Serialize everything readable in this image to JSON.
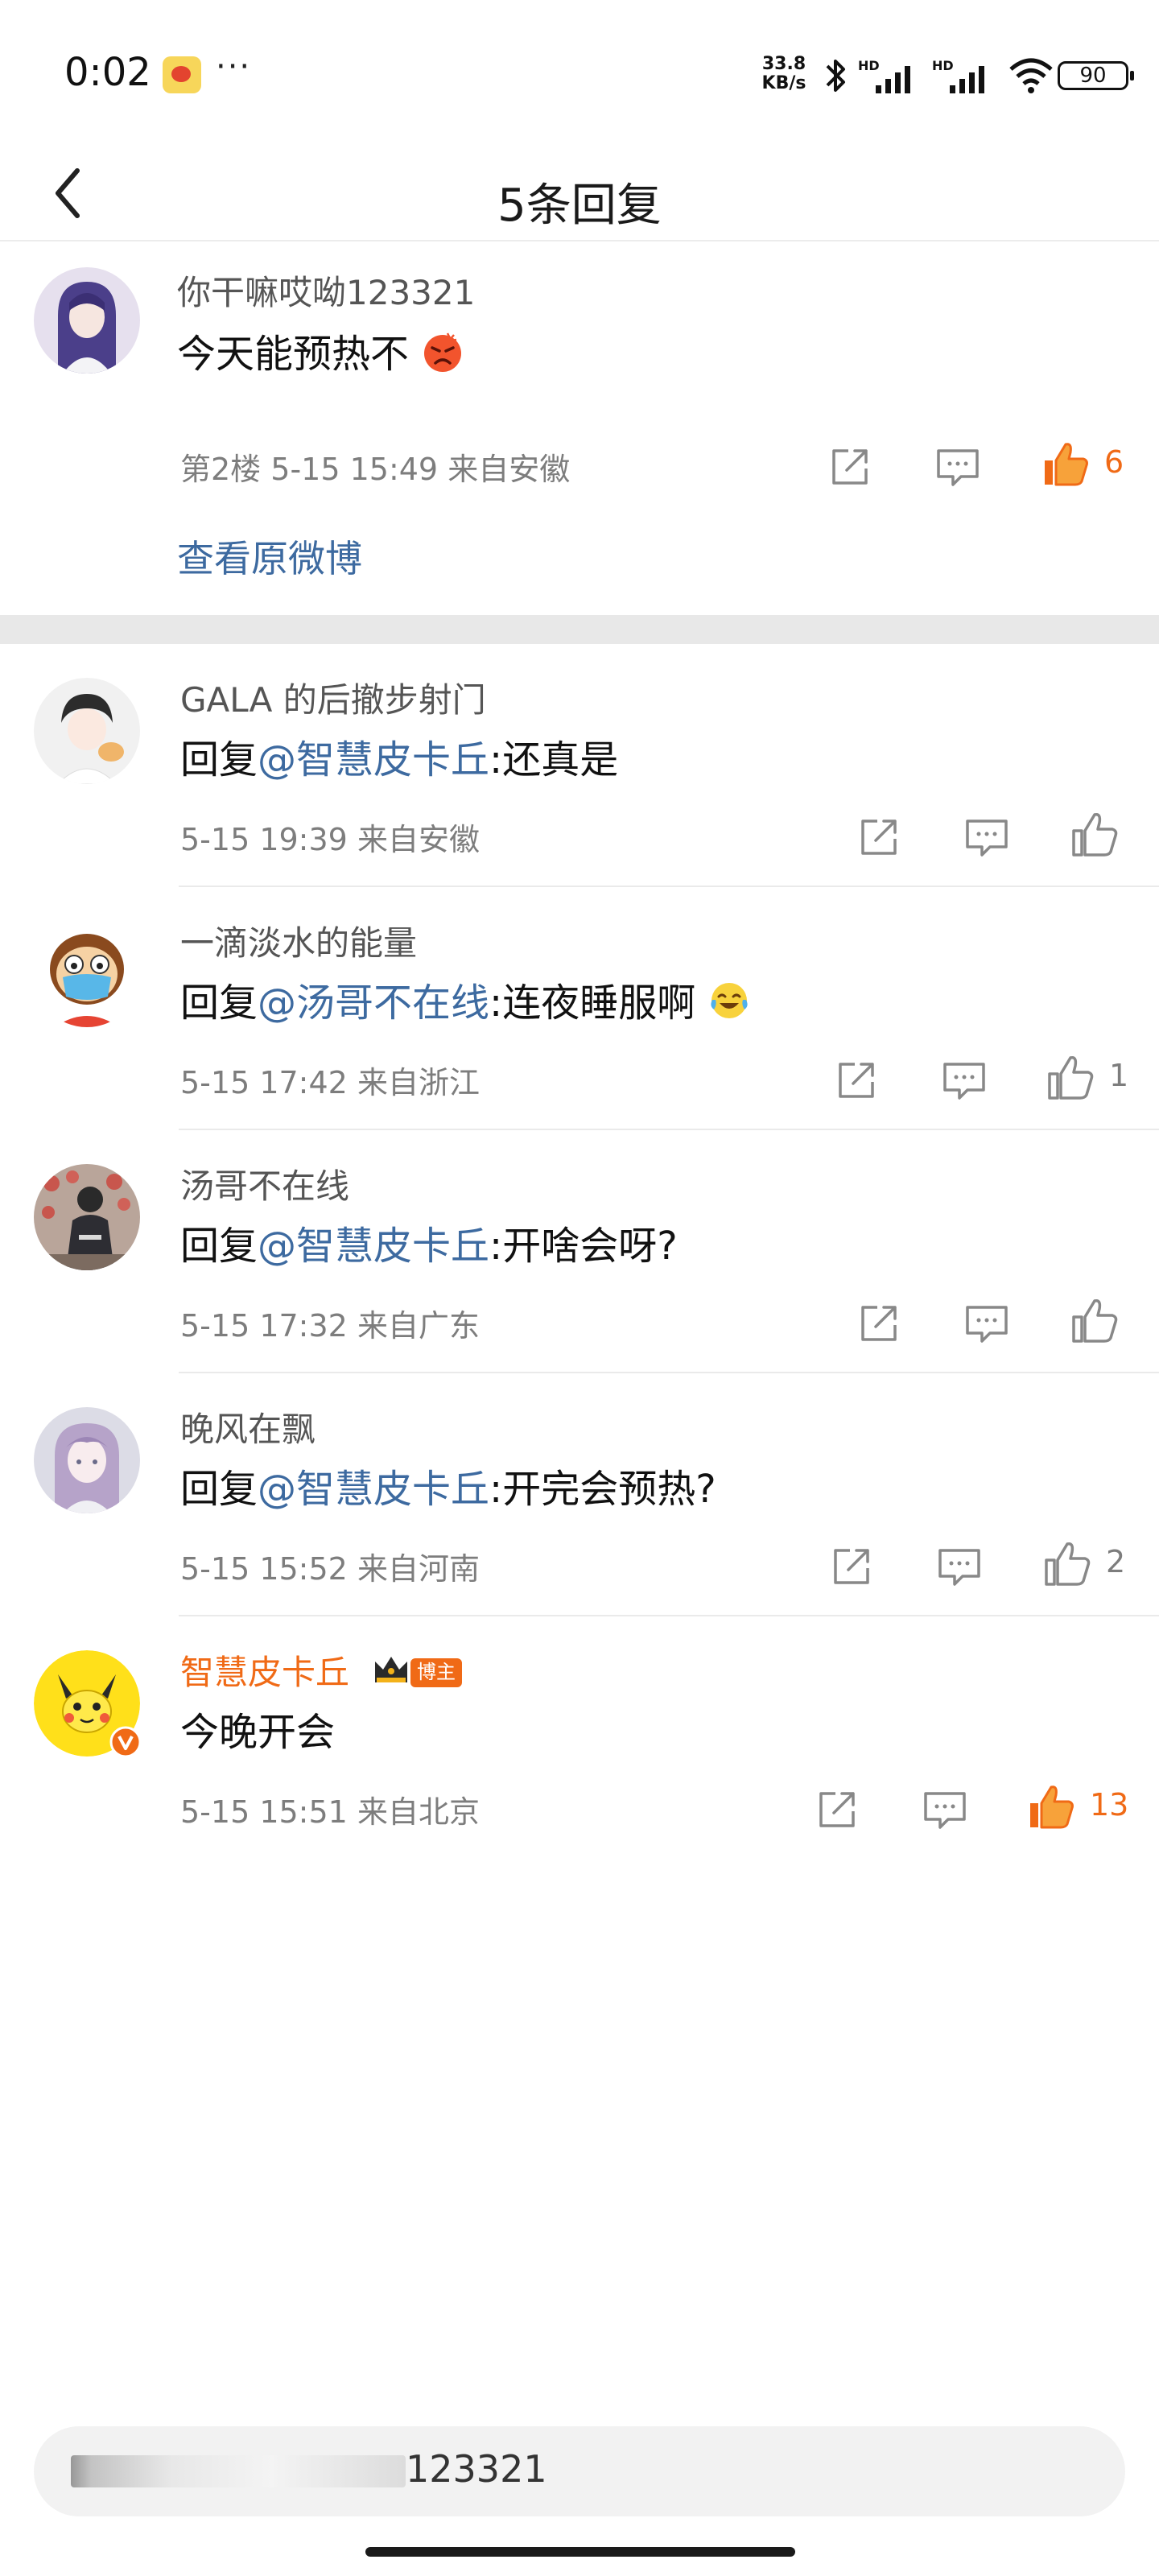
{
  "status_bar": {
    "time": "0:02",
    "app_icon": "weibo-icon",
    "more": "···",
    "net_speed_value": "33.8",
    "net_speed_unit": "KB/s",
    "hd_label": "HD",
    "battery": "90"
  },
  "header": {
    "back_icon": "chevron-left-icon",
    "title": "5条回复"
  },
  "root_comment": {
    "user": "你干嘛哎呦123321",
    "text": "今天能预热不",
    "emoji": "angry-face-icon",
    "floor": "第2楼",
    "time": "5-15 15:49",
    "location": "来自安徽",
    "likes": "6",
    "view_original": "查看原微博"
  },
  "replies": [
    {
      "user": "GALA 的后撤步射门",
      "prefix": "回复",
      "mention": "@智慧皮卡丘",
      "text": ":还真是",
      "time": "5-15 19:39",
      "location": "来自安徽",
      "likes": ""
    },
    {
      "user": "一滴淡水的能量",
      "prefix": "回复",
      "mention": "@汤哥不在线",
      "text": ":连夜睡服啊",
      "emoji": "laughing-tears-icon",
      "time": "5-15 17:42",
      "location": "来自浙江",
      "likes": "1"
    },
    {
      "user": "汤哥不在线",
      "prefix": "回复",
      "mention": "@智慧皮卡丘",
      "text": ":开啥会呀?",
      "time": "5-15 17:32",
      "location": "来自广东",
      "likes": ""
    },
    {
      "user": "晚风在飘",
      "prefix": "回复",
      "mention": "@智慧皮卡丘",
      "text": ":开完会预热?",
      "time": "5-15 15:52",
      "location": "来自河南",
      "likes": "2"
    },
    {
      "user": "智慧皮卡丘",
      "badge": "博主",
      "crown": "crown-icon",
      "verified": "verified-v-icon",
      "text": "今晚开会",
      "time": "5-15 15:51",
      "location": "来自北京",
      "likes": "13"
    }
  ],
  "input": {
    "placeholder": "123321"
  },
  "colors": {
    "link": "#3d6aa0",
    "accent_orange": "#f06a16",
    "meta_gray": "#7d7d7d",
    "divider": "#e8e8e8"
  }
}
